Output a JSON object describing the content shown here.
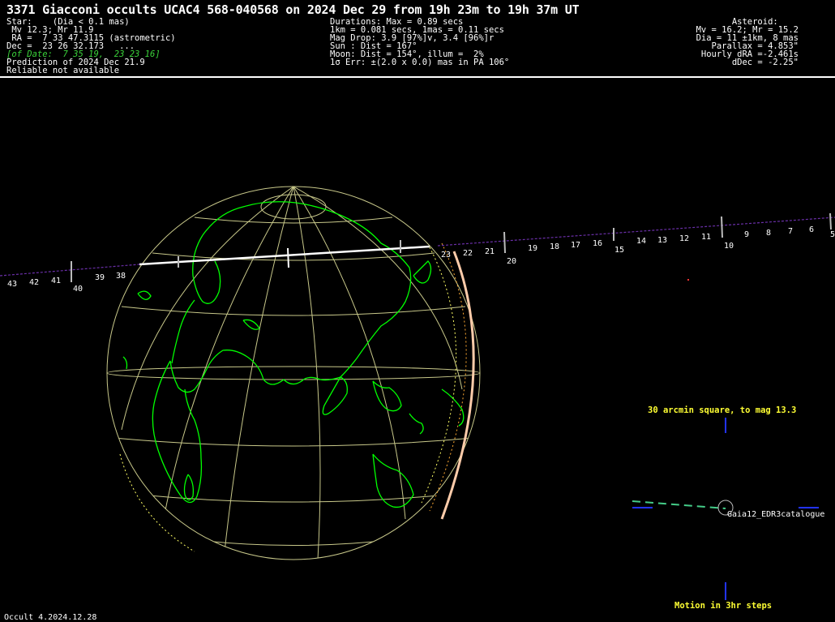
{
  "title": "3371 Giacconi occults UCAC4 568-040568 on 2024 Dec 29 from 19h 23m to 19h 37m UT",
  "star": {
    "line1": "Star:    (Dia < 0.1 mas)",
    "line2": " Mv 12.3; Mr 11.9",
    "line3": " RA =  7 33 47.3115 (astrometric)",
    "line4": "Dec =  23 26 32.173   ...",
    "line5": "[of Date:  7 35 19,  23 23 16]",
    "line6": "Prediction of 2024 Dec 21.9",
    "line7": "Reliable not available"
  },
  "event": {
    "line1": "Durations: Max = 0.89 secs",
    "line2": "1km = 0.081 secs, 1mas = 0.11 secs",
    "line3": "Mag Drop: 3.9 [97%]v, 3.4 [96%]r",
    "line4": "Sun : Dist = 167°",
    "line5": "Moon: Dist = 154°, illum =  2%",
    "line6": "1σ Err: ±(2.0 x 0.0) mas in PA 106°"
  },
  "asteroid": {
    "line1": "Asteroid:    ",
    "line2": "Mv = 16.2; Mr = 15.2",
    "line3": "Dia = 11 ±1km, 8 mas",
    "line4": "Parallax = 4.853\"",
    "line5": "Hourly dRA =-2.461s",
    "line6": "dDec = -2.25\""
  },
  "track_labels": {
    "hours": [
      "9",
      "6",
      "10",
      "15",
      "20",
      "40"
    ],
    "minutes": [
      "43",
      "42",
      "41",
      "39",
      "38",
      "23",
      "22",
      "21",
      "19",
      "18",
      "17",
      "16",
      "14",
      "13",
      "12",
      "11",
      "9",
      "8",
      "7",
      "6",
      "5"
    ]
  },
  "finder": {
    "fov_label": "30 arcmin square, to mag 13.3",
    "catalogue_label": "Gaia12_EDR3catalogue",
    "motion_label": "Motion in 3hr steps"
  },
  "footer": {
    "version": "Occult 4.2024.12.28"
  },
  "colors": {
    "background": "#000000",
    "text": "#ffffff",
    "highlight_text": "#ffff33",
    "coastline": "#00ff00",
    "graticule": "#c8c88a",
    "track": "#6a2fa8",
    "path_line": "#ffffff"
  }
}
